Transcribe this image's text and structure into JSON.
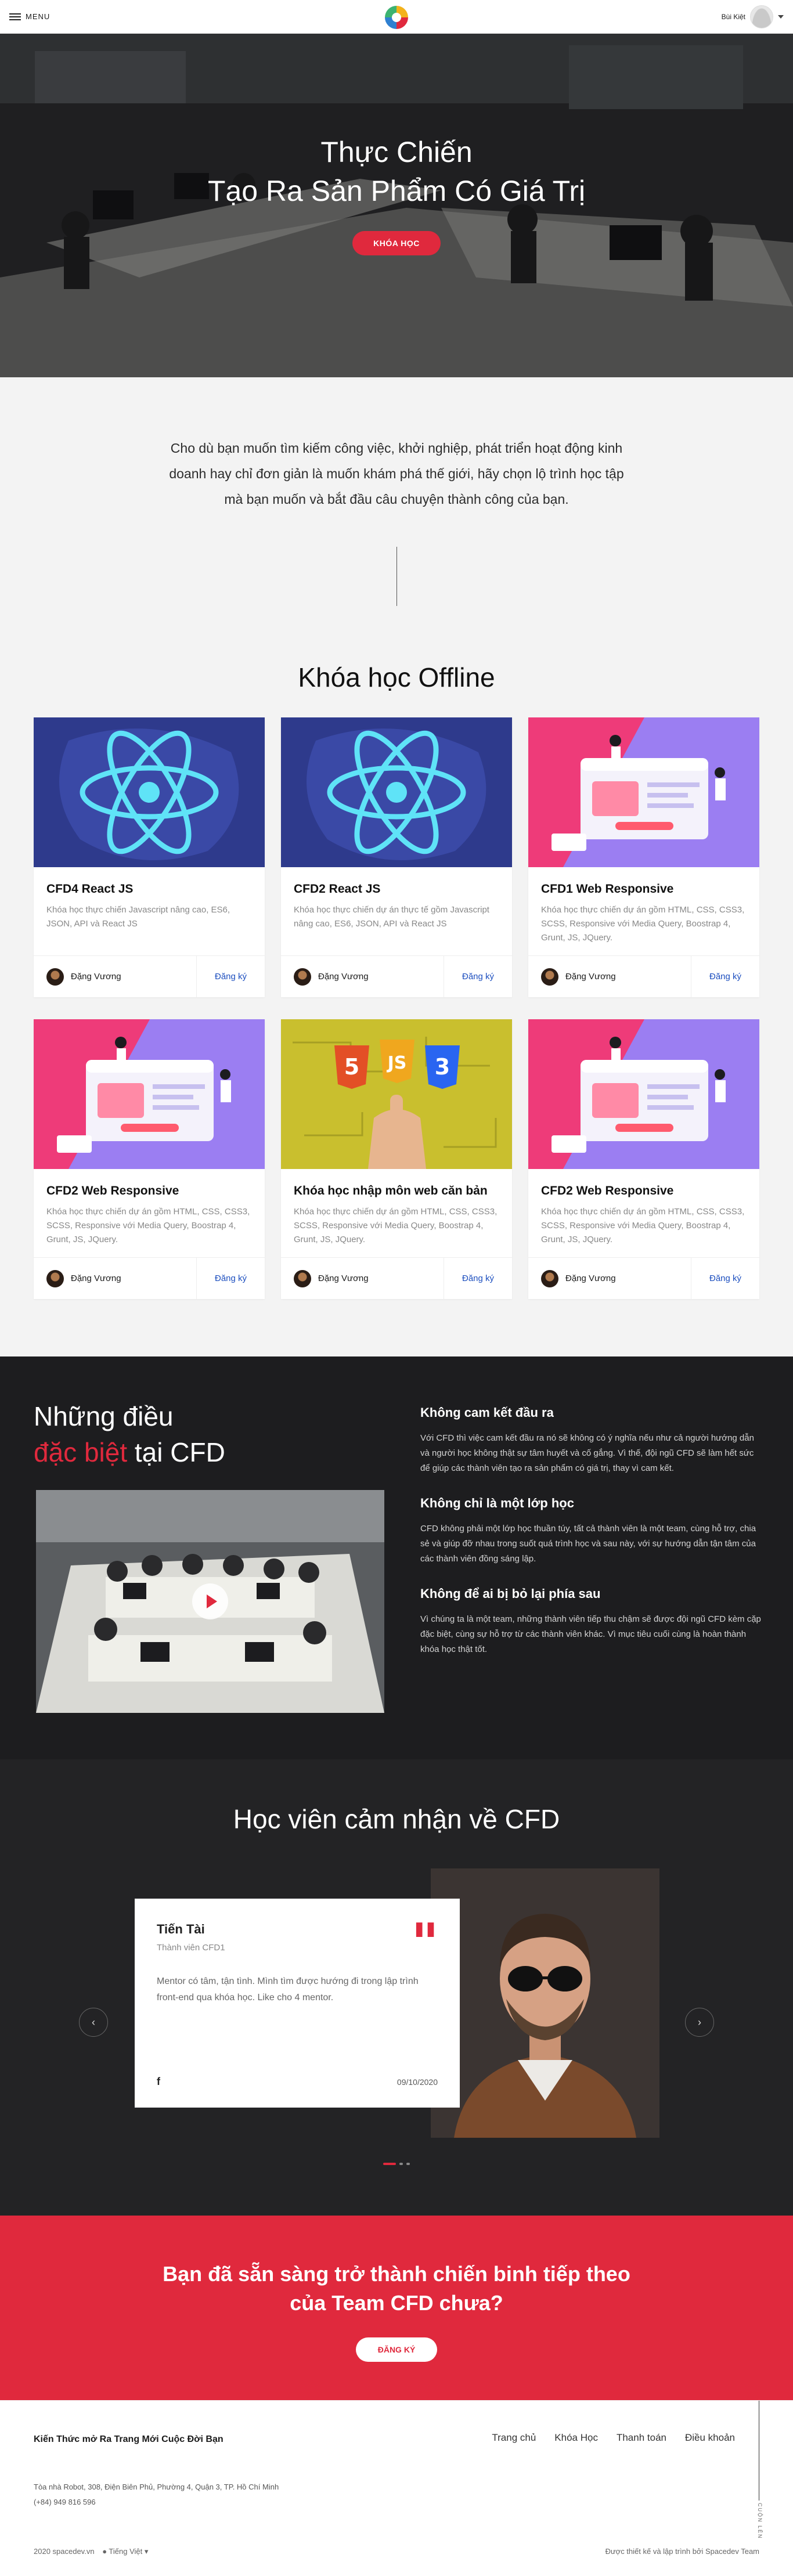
{
  "header": {
    "menu_label": "MENU",
    "user_name": "Bùi Kiệt"
  },
  "hero": {
    "title_line1": "Thực Chiến",
    "title_line2": "Tạo Ra Sản Phẩm Có Giá Trị",
    "button_label": "KHÓA HỌC"
  },
  "intro": {
    "text": "Cho dù bạn muốn tìm kiếm công việc, khởi nghiệp, phát triển hoạt động kinh doanh hay chỉ đơn giản là muốn khám phá thế giới, hãy chọn lộ trình học tập mà bạn muốn và bắt đầu câu chuyện thành công của bạn."
  },
  "offline": {
    "title": "Khóa học Offline",
    "courses": [
      {
        "name": "CFD4 React JS",
        "desc": "Khóa học thực chiến Javascript nâng cao, ES6, JSON, API và React JS",
        "author": "Đặng Vương",
        "action": "Đăng ký",
        "thumb": "react-icon"
      },
      {
        "name": "CFD2 React JS",
        "desc": "Khóa học thực chiến dự án thực tế gồm Javascript nâng cao, ES6, JSON, API và React JS",
        "author": "Đặng Vương",
        "action": "Đăng ký",
        "thumb": "react-icon"
      },
      {
        "name": "CFD1 Web Responsive",
        "desc": "Khóa học thực chiến dự án gồm HTML, CSS, CSS3, SCSS, Responsive với Media Query, Boostrap 4, Grunt, JS, JQuery.",
        "author": "Đặng Vương",
        "action": "Đăng ký",
        "thumb": "web-illustration"
      },
      {
        "name": "CFD2 Web Responsive",
        "desc": "Khóa học thực chiến dự án gồm HTML, CSS, CSS3, SCSS, Responsive với Media Query, Boostrap 4, Grunt, JS, JQuery.",
        "author": "Đặng Vương",
        "action": "Đăng ký",
        "thumb": "web-illustration"
      },
      {
        "name": "Khóa học nhập môn web căn bản",
        "desc": "Khóa học thực chiến dự án gồm HTML, CSS, CSS3, SCSS, Responsive với Media Query, Boostrap 4, Grunt, JS, JQuery.",
        "author": "Đặng Vương",
        "action": "Đăng ký",
        "thumb": "html-css-js-icon"
      },
      {
        "name": "CFD2 Web Responsive",
        "desc": "Khóa học thực chiến dự án gồm HTML, CSS, CSS3, SCSS, Responsive với Media Query, Boostrap 4, Grunt, JS, JQuery.",
        "author": "Đặng Vương",
        "action": "Đăng ký",
        "thumb": "web-illustration"
      }
    ]
  },
  "special": {
    "title_line1": "Những điều",
    "title_red": "đặc biệt",
    "title_rest": " tại CFD",
    "items": [
      {
        "title": "Không cam kết đầu ra",
        "text": "Với CFD thì việc cam kết đầu ra nó sẽ không có ý nghĩa nếu như cả người hướng dẫn và người học không thật sự tâm huyết và cố gắng. Vì thế, đội ngũ CFD sẽ làm hết sức để giúp các thành viên tạo ra sản phẩm có giá trị, thay vì cam kết."
      },
      {
        "title": "Không chỉ là một lớp học",
        "text": "CFD không phải một lớp học thuần túy, tất cả thành viên là một team, cùng hỗ trợ, chia sẻ và giúp đỡ nhau trong suốt quá trình học và sau này, với sự hướng dẫn tận tâm của các thành viên đồng sáng lập."
      },
      {
        "title": "Không để ai bị bỏ lại phía sau",
        "text": "Vì chúng ta là một team, những thành viên tiếp thu chậm sẽ được đội ngũ CFD kèm cặp đặc biệt, cùng sự hỗ trợ từ các thành viên khác. Vì mục tiêu cuối cùng là hoàn thành khóa học thật tốt."
      }
    ]
  },
  "testimonials": {
    "title": "Học viên cảm nhận về CFD",
    "name": "Tiến Tài",
    "role": "Thành viên CFD1",
    "text": "Mentor có tâm, tận tình. Mình tìm được hướng đi trong lập trình front-end qua khóa học. Like cho 4 mentor.",
    "facebook": "f",
    "date": "09/10/2020",
    "prev": "‹",
    "next": "›"
  },
  "cta": {
    "line1": "Bạn đã sẵn sàng trở thành chiến binh tiếp theo",
    "line2": "của Team CFD chưa?",
    "button_label": "ĐĂNG KÝ"
  },
  "footer": {
    "title": "Kiến Thức mở Ra Trang Mới Cuộc Đời Bạn",
    "nav": [
      "Trang chủ",
      "Khóa Học",
      "Thanh toán",
      "Điều khoản"
    ],
    "address": "Tòa nhà Robot, 308, Điện Biên Phủ, Phường 4, Quận 3, TP. Hồ Chí Minh",
    "phone": "(+84) 949 816 596",
    "copyright": "2020 spacedev.vn",
    "language": "Tiếng Việt",
    "credit": "Được thiết kế và lập trình bởi Spacedev Team",
    "vertical": "CUỘN LÊN"
  },
  "colors": {
    "accent": "#e0293d",
    "dark": "#1d1d1f",
    "link": "#1d4fbf"
  }
}
